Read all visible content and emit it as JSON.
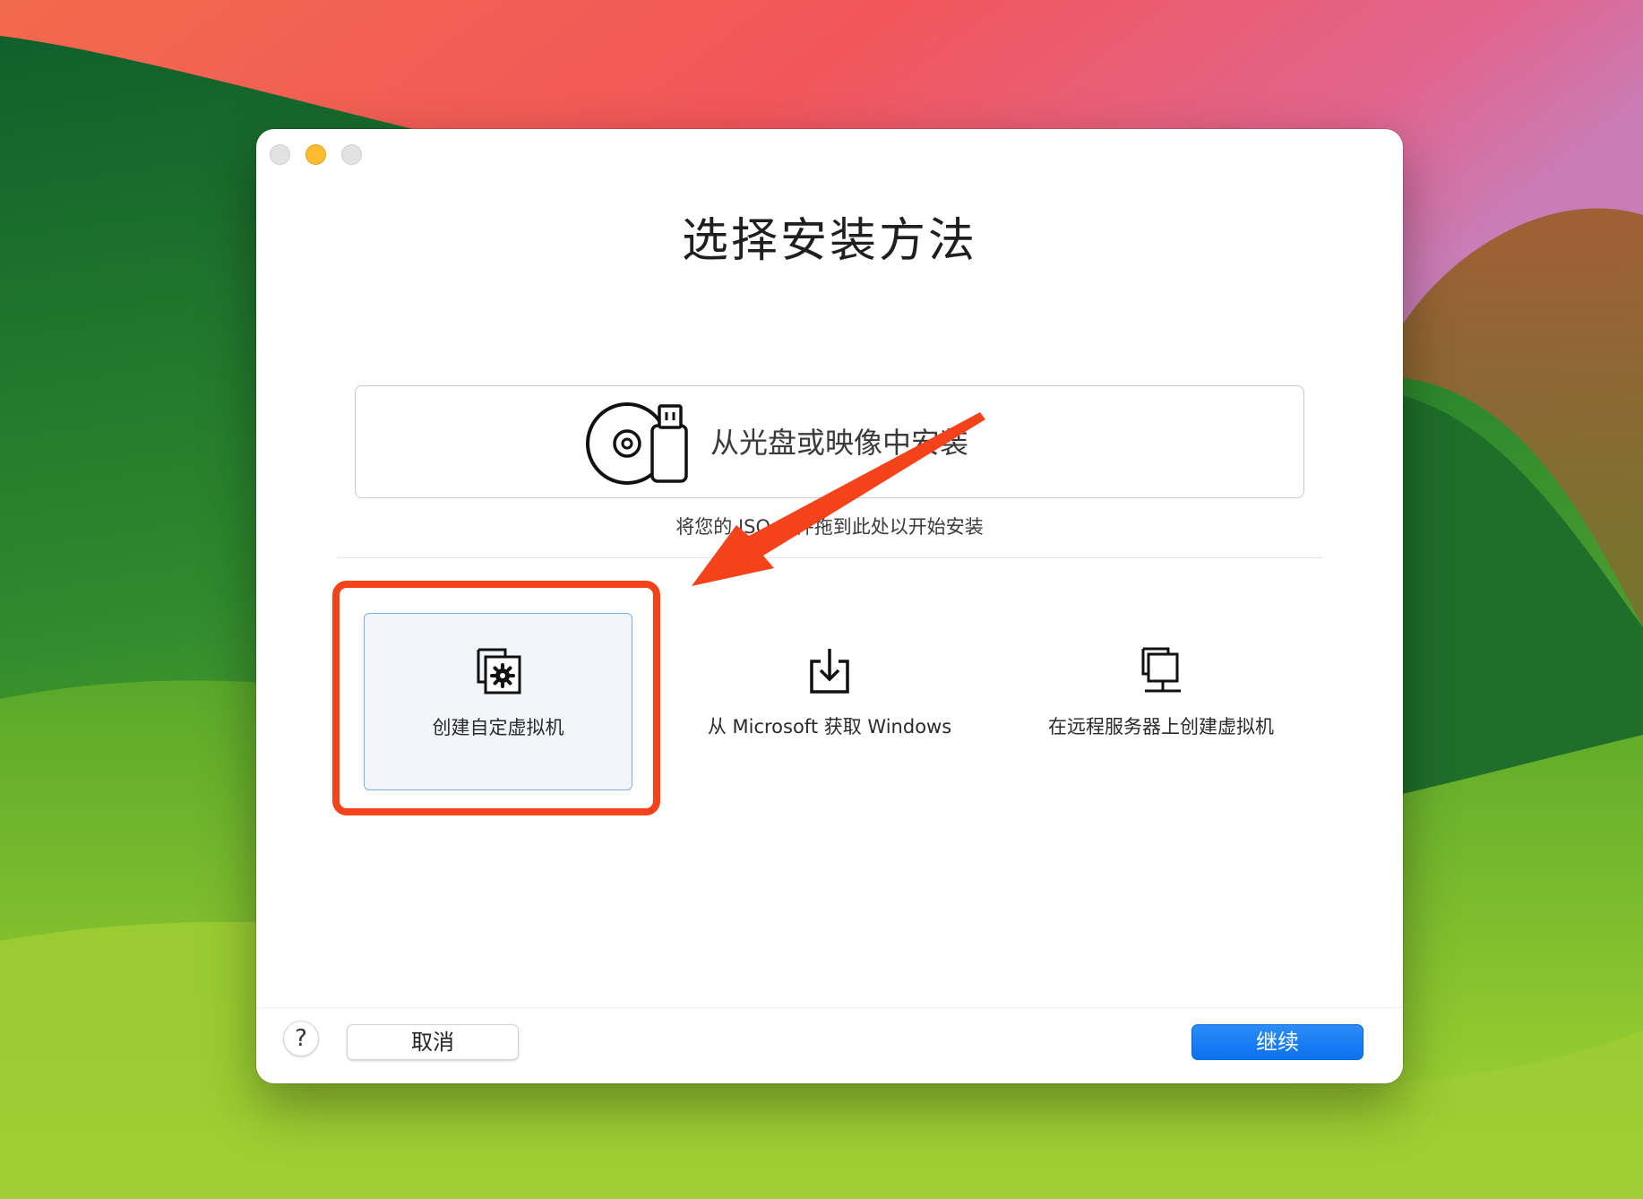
{
  "window": {
    "title": "选择安装方法"
  },
  "drop_zone": {
    "label": "从光盘或映像中安装",
    "hint": "将您的 ISO 文件拖到此处以开始安装",
    "icon": "disc-usb-icon"
  },
  "options": [
    {
      "label": "创建自定虚拟机",
      "icon": "custom-vm-gear-icon",
      "selected": true
    },
    {
      "label": "从 Microsoft 获取 Windows",
      "icon": "download-tray-icon",
      "selected": false
    },
    {
      "label": "在远程服务器上创建虚拟机",
      "icon": "remote-server-icon",
      "selected": false
    }
  ],
  "buttons": {
    "help": "?",
    "cancel": "取消",
    "continue": "继续"
  },
  "colors": {
    "accent": "#0a71f0",
    "selection_border": "#7fb0e4",
    "annotation": "#f4421b"
  }
}
